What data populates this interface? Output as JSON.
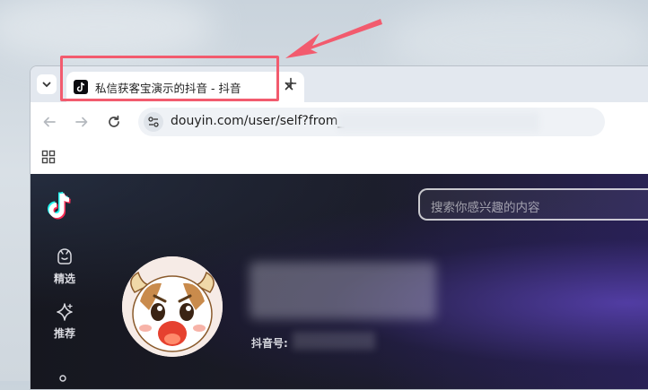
{
  "browser": {
    "tab": {
      "title": "私信获客宝演示的抖音 - 抖音"
    },
    "address_bar": {
      "url": "douyin.com/user/self?from_"
    }
  },
  "page": {
    "search": {
      "placeholder": "搜索你感兴趣的内容"
    },
    "sidebar": {
      "items": [
        {
          "label": "精选",
          "icon": "featured-icon"
        },
        {
          "label": "推荐",
          "icon": "recommend-sparkle-icon"
        }
      ]
    },
    "profile": {
      "id_label": "抖音号:"
    }
  },
  "annotation": {
    "color": "#f25b6e"
  },
  "colors": {
    "brand_cyan": "#25f4ee",
    "brand_red": "#fe2c55"
  }
}
